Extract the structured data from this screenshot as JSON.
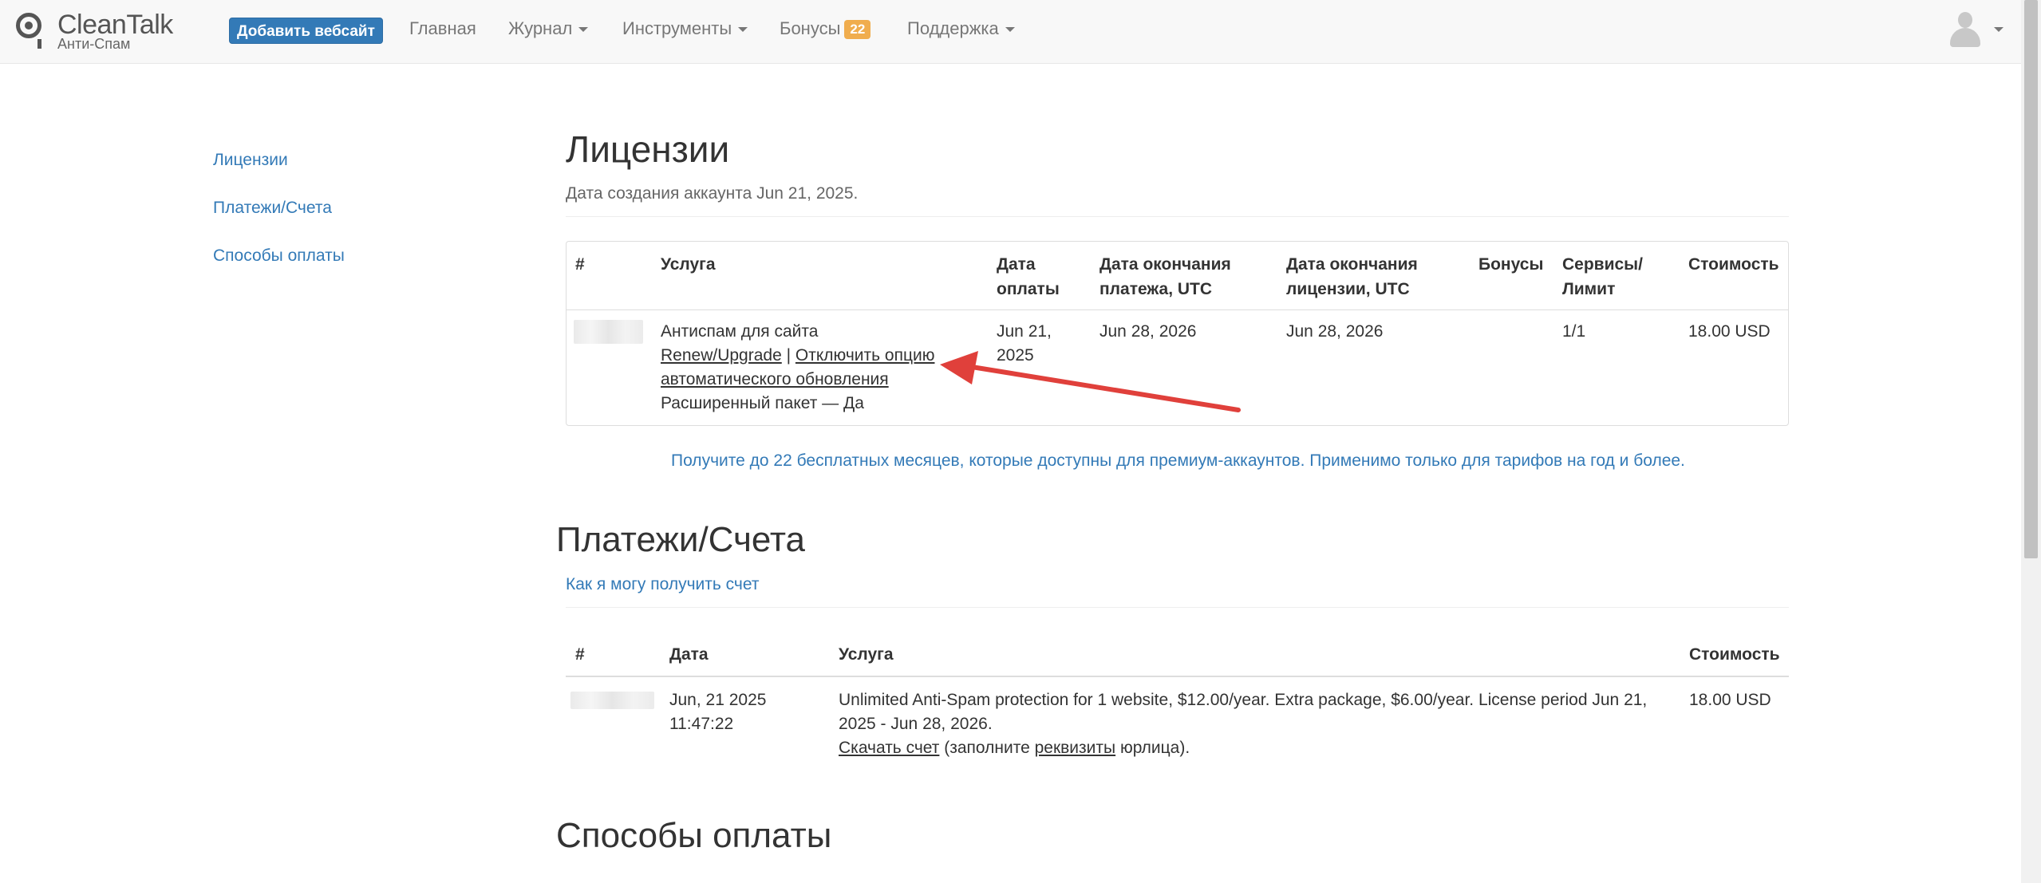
{
  "navbar": {
    "logo_name": "CleanTalk",
    "logo_sub": "Анти-Спам",
    "add_site_label": "Добавить вебсайт",
    "items": [
      {
        "label": "Главная"
      },
      {
        "label": "Журнал"
      },
      {
        "label": "Инструменты"
      },
      {
        "label": "Бонусы",
        "badge": "22"
      },
      {
        "label": "Поддержка"
      }
    ]
  },
  "sidebar": {
    "items": [
      {
        "label": "Лицензии"
      },
      {
        "label": "Платежи/Счета"
      },
      {
        "label": "Способы оплаты"
      }
    ]
  },
  "licenses": {
    "title": "Лицензии",
    "created": "Дата создания аккаунта Jun 21, 2025.",
    "headers": {
      "num": "#",
      "service": "Услуга",
      "pay_date_1": "Дата",
      "pay_date_2": "оплаты",
      "pay_end_1": "Дата окончания",
      "pay_end_2": "платежа, UTC",
      "lic_end_1": "Дата окончания",
      "lic_end_2": "лицензии, UTC",
      "bonus": "Бонусы",
      "services_1": "Сервисы/",
      "services_2": "Лимит",
      "cost": "Стоимость"
    },
    "row": {
      "service_name": "Антиспам для сайта",
      "renew_link": "Renew/Upgrade",
      "separator": "|",
      "disable_auto_1": "Отключить опцию",
      "disable_auto_2": "автоматического обновления",
      "extended": "Расширенный пакет — Да",
      "pay_date_1": "Jun 21,",
      "pay_date_2": "2025",
      "pay_end": "Jun 28, 2026",
      "lic_end": "Jun 28, 2026",
      "services": "1/1",
      "cost": "18.00 USD"
    },
    "promo": "Получите до 22 бесплатных месяцев, которые доступны для премиум-аккаунтов. Применимо только для тарифов на год и более."
  },
  "payments": {
    "title": "Платежи/Счета",
    "howto": "Как я могу получить счет",
    "headers": {
      "num": "#",
      "date": "Дата",
      "service": "Услуга",
      "cost": "Стоимость"
    },
    "row": {
      "date_1": "Jun, 21 2025",
      "date_2": "11:47:22",
      "desc_1": "Unlimited Anti-Spam protection for 1 website, $12.00/year. Extra package, $6.00/year. License period Jun 21,",
      "desc_2": "2025 - Jun 28, 2026.",
      "download": "Скачать счет",
      "fill_pre": " (заполните ",
      "requisites": "реквизиты",
      "fill_post": " юрлица).",
      "cost": "18.00 USD"
    }
  },
  "methods": {
    "title": "Способы оплаты"
  },
  "colors": {
    "link": "#337ab7",
    "badge": "#f0ad4e",
    "arrow": "#e0403b"
  }
}
